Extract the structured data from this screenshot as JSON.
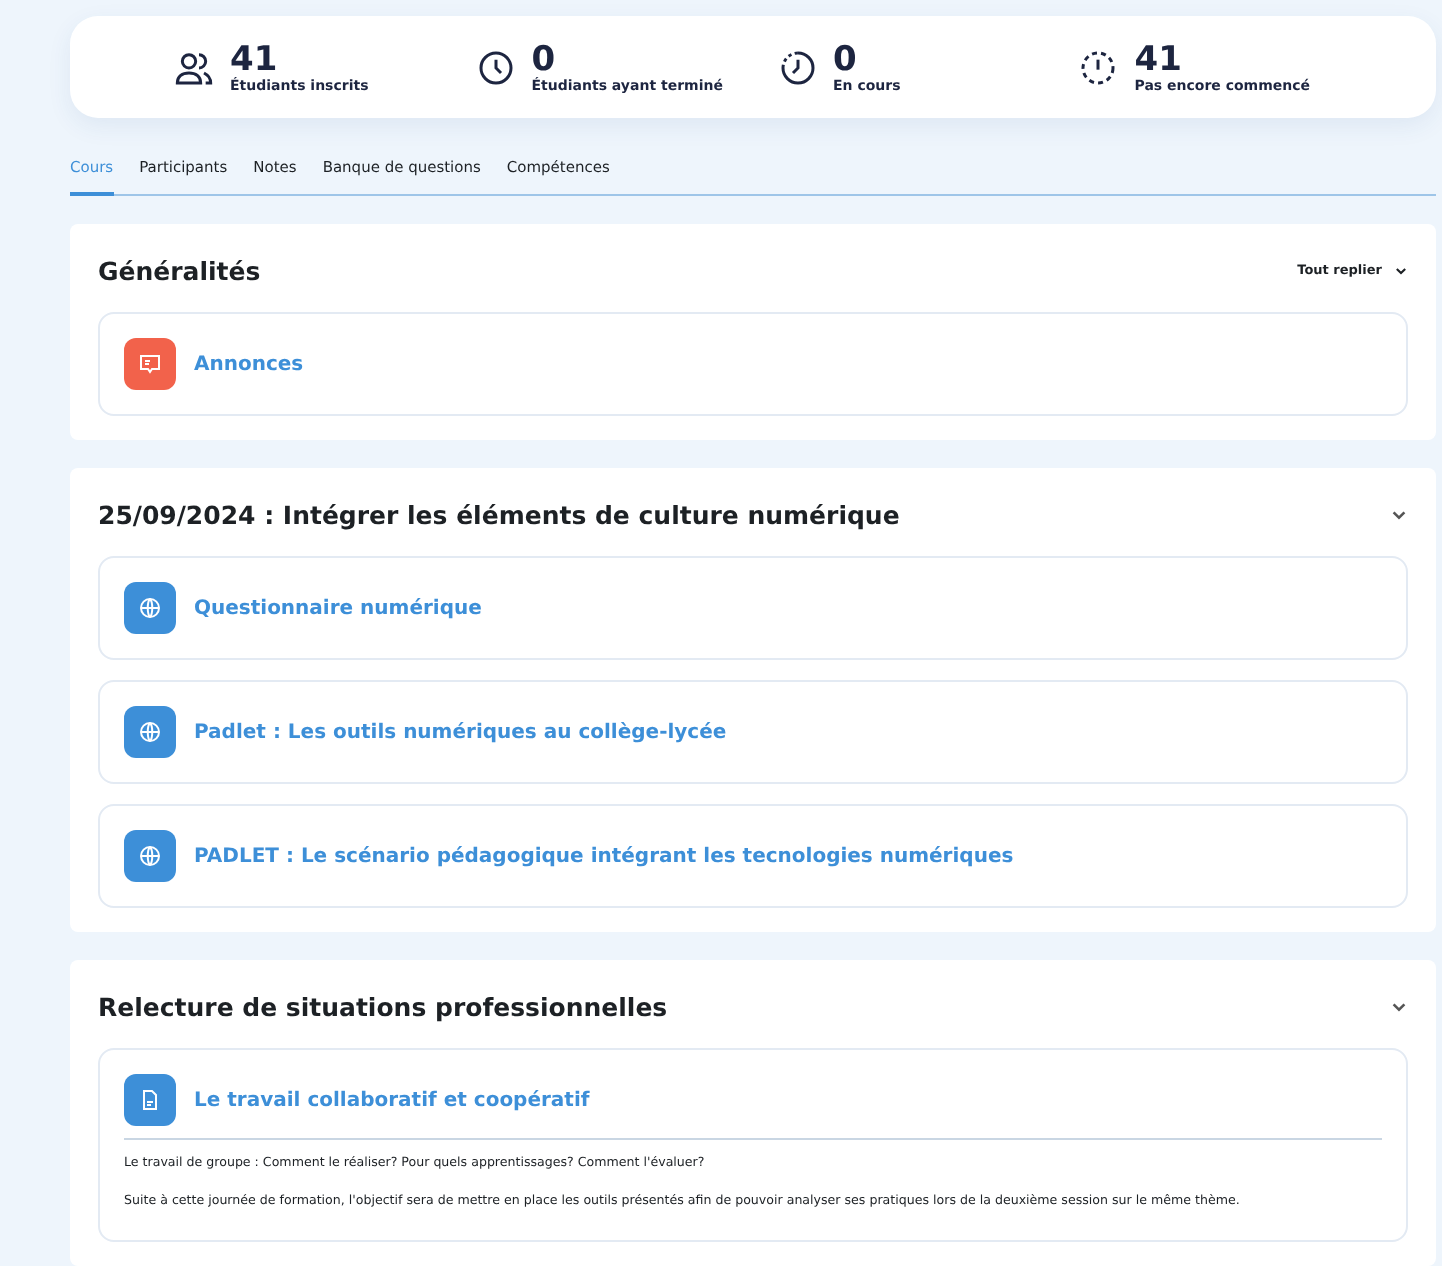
{
  "stats": [
    {
      "kind": "users",
      "value": "41",
      "label": "Étudiants inscrits"
    },
    {
      "kind": "clock",
      "value": "0",
      "label": "Étudiants ayant terminé"
    },
    {
      "kind": "progress",
      "value": "0",
      "label": "En cours"
    },
    {
      "kind": "dashed",
      "value": "41",
      "label": "Pas encore commencé"
    }
  ],
  "tabs": [
    {
      "label": "Cours",
      "selected": true
    },
    {
      "label": "Participants",
      "selected": false
    },
    {
      "label": "Notes",
      "selected": false
    },
    {
      "label": "Banque de questions",
      "selected": false
    },
    {
      "label": "Compétences",
      "selected": false
    }
  ],
  "sections": [
    {
      "title": "Généralités",
      "action": "Tout replier",
      "activities": [
        {
          "kind": "announcement",
          "title": "Annonces"
        }
      ]
    },
    {
      "title": "25/09/2024 : Intégrer les éléments de culture numérique",
      "activities": [
        {
          "kind": "url",
          "title": "Questionnaire numérique"
        },
        {
          "kind": "url",
          "title": "Padlet : Les outils numériques au collège-lycée"
        },
        {
          "kind": "url",
          "title": "PADLET : Le scénario pédagogique intégrant les tecnologies numériques"
        }
      ]
    },
    {
      "title": "Relecture de situations professionnelles",
      "activities": [
        {
          "kind": "file",
          "title": "Le travail collaboratif et coopératif",
          "description": [
            "Le travail de groupe : Comment le réaliser? Pour quels apprentissages? Comment l'évaluer?",
            "Suite à cette journée de formation, l'objectif sera de mettre en place les outils présentés afin de pouvoir analyser ses pratiques lors de la deuxième session sur le même thème."
          ]
        }
      ]
    }
  ]
}
